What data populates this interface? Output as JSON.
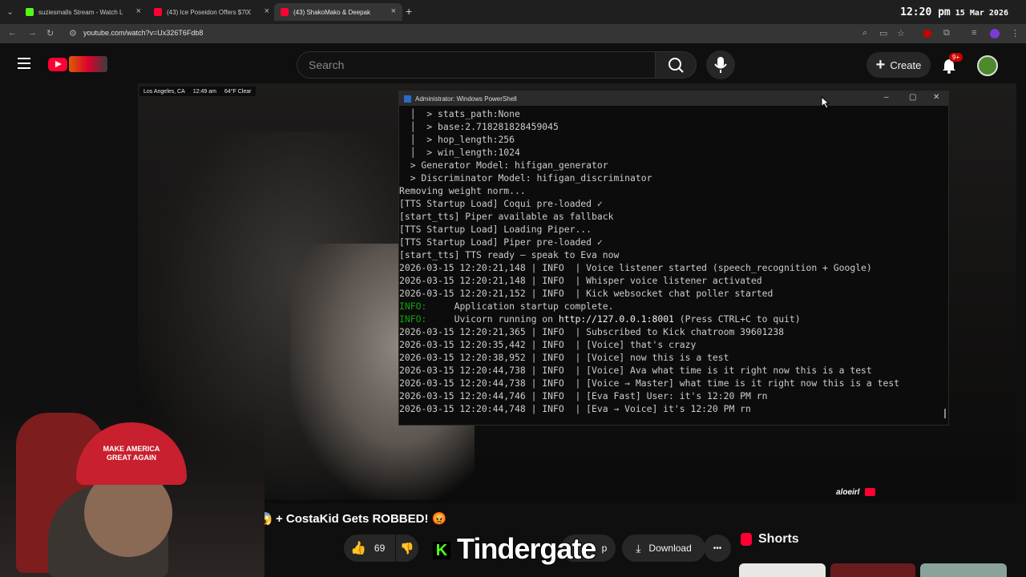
{
  "browser": {
    "tabs": [
      {
        "title": "suziesmalls Stream - Watch Liv",
        "color": "#53fc18"
      },
      {
        "title": "(43) Ice Poseidon Offers $700K",
        "color": "#ff0033"
      },
      {
        "title": "(43) ShakoMako & Deepak",
        "color": "#ff0033",
        "active": true
      }
    ],
    "new_tab": "+",
    "url": "youtube.com/watch?v=Ux326T6Fdb8",
    "clock_time": "12:20 pm",
    "clock_date": "15 Mar 2026"
  },
  "youtube": {
    "search_placeholder": "Search",
    "create_label": "Create",
    "notif_badge": "9+",
    "like_count": "69",
    "download_label": "Download",
    "share_label": "p",
    "shorts_label": "Shorts",
    "more_label": "•••"
  },
  "video": {
    "weather": {
      "location": "Los Angeles, CA",
      "time": "12:49 am",
      "temp": "64°F Clear"
    },
    "channel_tag": "aloeirl",
    "title_line": "! 😱 + CostaKid Gets ROBBED! 😡",
    "overlay_text": "Tindergate",
    "hat_text": "MAKE AMERICA GREAT AGAIN"
  },
  "powershell": {
    "title": "Administrator: Windows PowerShell",
    "lines": [
      {
        "text": "  │  > stats_path:None",
        "color": "#cccccc"
      },
      {
        "text": "  │  > base:2.718281828459045",
        "color": "#cccccc"
      },
      {
        "text": "  │  > hop_length:256",
        "color": "#cccccc"
      },
      {
        "text": "  │  > win_length:1024",
        "color": "#cccccc"
      },
      {
        "text": "  > Generator Model: hifigan_generator",
        "color": "#cccccc"
      },
      {
        "text": "  > Discriminator Model: hifigan_discriminator",
        "color": "#cccccc"
      },
      {
        "text": "Removing weight norm...",
        "color": "#cccccc"
      },
      {
        "text": "[TTS Startup Load] Coqui pre-loaded ✓",
        "color": "#cccccc"
      },
      {
        "text": "[start_tts] Piper available as fallback",
        "color": "#cccccc"
      },
      {
        "text": "[TTS Startup Load] Loading Piper...",
        "color": "#cccccc"
      },
      {
        "text": "[TTS Startup Load] Piper pre-loaded ✓",
        "color": "#cccccc"
      },
      {
        "text": "[start_tts] TTS ready — speak to Eva now",
        "color": "#cccccc"
      },
      {
        "text": "2026-03-15 12:20:21,148 | INFO  | Voice listener started (speech_recognition + Google)",
        "color": "#cccccc"
      },
      {
        "text": "2026-03-15 12:20:21,148 | INFO  | Whisper voice listener activated",
        "color": "#cccccc"
      },
      {
        "text": "2026-03-15 12:20:21,152 | INFO  | Kick websocket chat poller started",
        "color": "#cccccc"
      },
      {
        "prefix": "INFO:",
        "text": "     Application startup complete.",
        "color": "#cccccc"
      },
      {
        "prefix": "INFO:",
        "text": "     Uvicorn running on ",
        "link": "http://127.0.0.1:8001",
        "suffix": " (Press CTRL+C to quit)",
        "color": "#cccccc"
      },
      {
        "text": "2026-03-15 12:20:21,365 | INFO  | Subscribed to Kick chatroom 39601238",
        "color": "#cccccc"
      },
      {
        "text": "2026-03-15 12:20:35,442 | INFO  | [Voice] that's crazy",
        "color": "#cccccc"
      },
      {
        "text": "2026-03-15 12:20:38,952 | INFO  | [Voice] now this is a test",
        "color": "#cccccc"
      },
      {
        "text": "2026-03-15 12:20:44,738 | INFO  | [Voice] Ava what time is it right now this is a test",
        "color": "#cccccc"
      },
      {
        "text": "2026-03-15 12:20:44,738 | INFO  | [Voice → Master] what time is it right now this is a test",
        "color": "#cccccc"
      },
      {
        "text": "2026-03-15 12:20:44,746 | INFO  | [Eva Fast] User: it's 12:20 PM rn",
        "color": "#cccccc"
      },
      {
        "text": "2026-03-15 12:20:44,748 | INFO  | [Eva → Voice] it's 12:20 PM rn",
        "color": "#cccccc"
      }
    ]
  },
  "colors": {
    "yt_red": "#ff0033",
    "kick_green": "#53fc18",
    "info_green": "#13a10e",
    "link_blue": "#61d6d6"
  }
}
